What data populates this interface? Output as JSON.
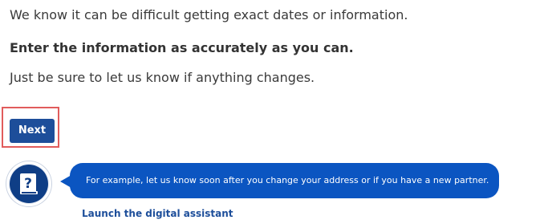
{
  "content": {
    "intro_text": "We know it can be difficult getting exact dates or information.",
    "emphasis_text": "Enter the information as accurately as you can.",
    "note_text": "Just be sure to let us know if anything changes."
  },
  "actions": {
    "next_label": "Next"
  },
  "assistant": {
    "icon": "help-book-icon",
    "message": "For example, let us know soon after you change your address or if you have a new partner.",
    "link_label": "Launch the digital assistant"
  },
  "colors": {
    "primary_button": "#1d4e9a",
    "bubble": "#0b55c1",
    "highlight": "#e15c5c",
    "avatar": "#0f3e86"
  }
}
